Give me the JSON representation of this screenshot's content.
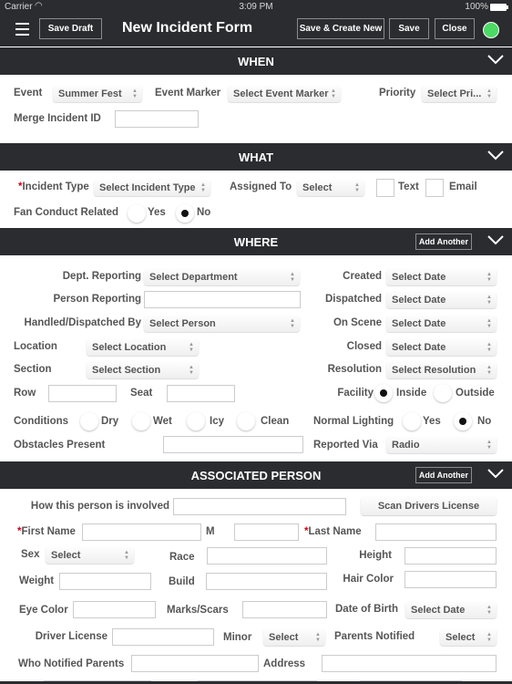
{
  "status_bar": {
    "carrier": "Carrier",
    "wifi_icon": "wifi-icon",
    "time": "3:09 PM",
    "battery": "100%",
    "battery_icon": "battery-icon"
  },
  "navbar": {
    "menu_icon": "hamburger-menu-icon",
    "save_draft": "Save Draft",
    "title": "New Incident Form",
    "save_create_new": "Save & Create New",
    "save": "Save",
    "close": "Close",
    "status_color": "#4cd964"
  },
  "when": {
    "title": "WHEN",
    "event_label": "Event",
    "event_value": "Summer Fest",
    "event_marker_label": "Event Marker",
    "event_marker_value": "Select Event Marker",
    "priority_label": "Priority",
    "priority_value": "Select Pri...",
    "merge_label": "Merge Incident ID",
    "merge_value": ""
  },
  "what": {
    "title": "WHAT",
    "incident_type_label": "Incident Type",
    "incident_type_value": "Select Incident Type",
    "assigned_label": "Assigned To",
    "assigned_value": "Select",
    "text_label": "Text",
    "text_checked": false,
    "email_label": "Email",
    "email_checked": false,
    "fan_conduct_label": "Fan Conduct Related",
    "fan_conduct_options": [
      "Yes",
      "No"
    ],
    "fan_conduct_selected": "No"
  },
  "where": {
    "title": "WHERE",
    "add_another": "Add Another",
    "dept_label": "Dept. Reporting",
    "dept_value": "Select Department",
    "person_reporting_label": "Person Reporting",
    "person_reporting_value": "",
    "handled_label": "Handled/Dispatched By",
    "handled_value": "Select Person",
    "location_label": "Location",
    "location_value": "Select Location",
    "section_label": "Section",
    "section_value": "Select Section",
    "row_label": "Row",
    "seat_label": "Seat",
    "created_label": "Created",
    "created_value": "Select Date",
    "dispatched_label": "Dispatched",
    "dispatched_value": "Select Date",
    "on_scene_label": "On Scene",
    "on_scene_value": "Select Date",
    "closed_label": "Closed",
    "closed_value": "Select Date",
    "resolution_label": "Resolution",
    "resolution_value": "Select Resolution",
    "facility_label": "Facility",
    "facility_options": [
      "Inside",
      "Outside"
    ],
    "facility_selected": "Inside",
    "conditions_label": "Conditions",
    "conditions_options": [
      "Dry",
      "Wet",
      "Icy",
      "Clean"
    ],
    "conditions_selected": null,
    "lighting_label": "Normal Lighting",
    "lighting_options": [
      "Yes",
      "No"
    ],
    "lighting_selected": "No",
    "obstacles_label": "Obstacles Present",
    "obstacles_value": "",
    "reported_via_label": "Reported Via",
    "reported_via_value": "Radio"
  },
  "person": {
    "title": "ASSOCIATED PERSON",
    "add_another": "Add Another",
    "involved_label": "How this person is involved",
    "scan_button": "Scan Drivers License",
    "first_name_label": "First Name",
    "m_label": "M",
    "last_name_label": "Last Name",
    "sex_label": "Sex",
    "sex_value": "Select",
    "race_label": "Race",
    "height_label": "Height",
    "weight_label": "Weight",
    "build_label": "Build",
    "hair_label": "Hair Color",
    "eye_label": "Eye Color",
    "marks_label": "Marks/Scars",
    "dob_label": "Date of Birth",
    "dob_value": "Select Date",
    "license_label": "Driver License",
    "minor_label": "Minor",
    "minor_value": "Select",
    "parents_notified_label": "Parents Notified",
    "parents_notified_value": "Select",
    "who_notified_label": "Who Notified Parents",
    "address_label": "Address"
  }
}
